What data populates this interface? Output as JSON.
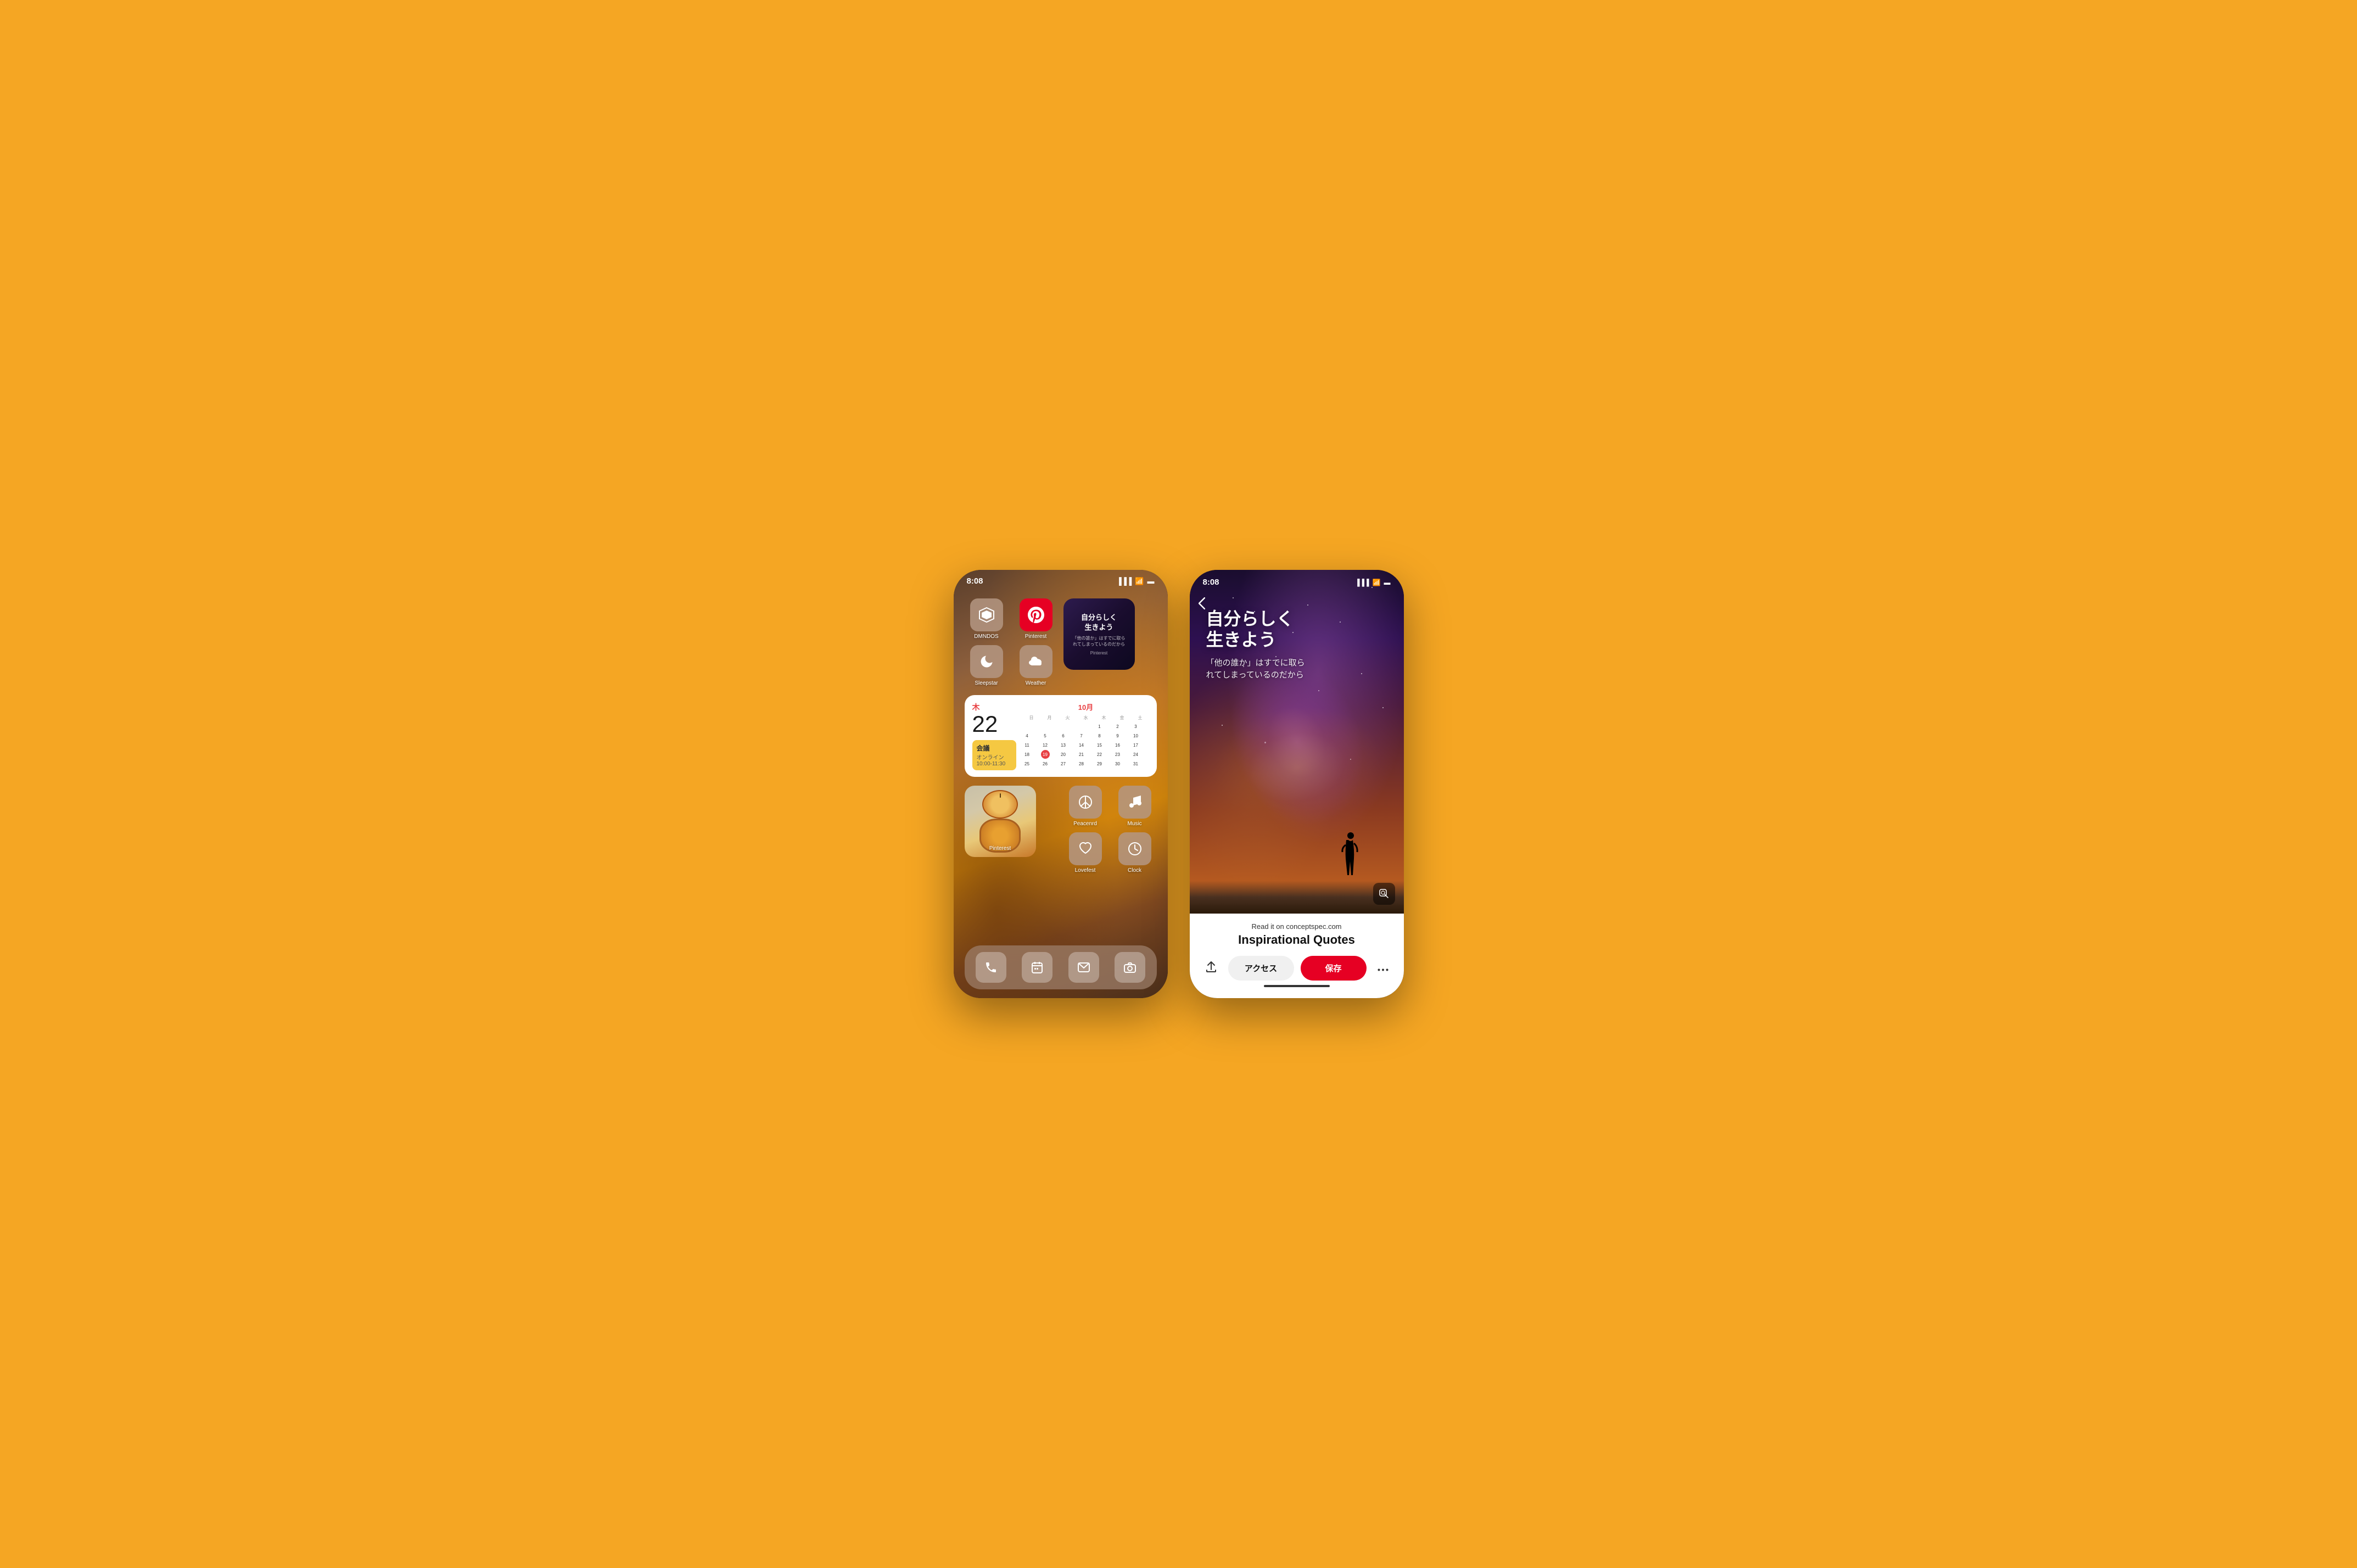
{
  "background": "#F5A623",
  "left_phone": {
    "status_time": "8:08",
    "apps_row1": [
      {
        "id": "dmndos",
        "label": "DMNDOS",
        "icon": "◇",
        "bg": "dmndos"
      },
      {
        "id": "pinterest",
        "label": "Pinterest",
        "icon": "P",
        "bg": "pinterest-red"
      }
    ],
    "widget_quote": {
      "main": "自分らしく\n生きよう",
      "sub": "「他の誰か」はすでに取ら\nれてしまっているのだから",
      "label": "Pinterest"
    },
    "apps_row2": [
      {
        "id": "sleepstar",
        "label": "Sleepstar",
        "icon": "☽",
        "bg": "sleepstar"
      },
      {
        "id": "weather",
        "label": "Weather",
        "icon": "⛅",
        "bg": "weather"
      }
    ],
    "calendar": {
      "day_label": "木",
      "date": "22",
      "month_label": "10月",
      "event_title": "会議",
      "event_loc": "オンライン",
      "event_time": "10:00-11:30",
      "days_header": [
        "日",
        "月",
        "火",
        "水",
        "木",
        "金",
        "土"
      ],
      "weeks": [
        [
          "",
          "",
          "",
          "",
          "1",
          "2",
          "3"
        ],
        [
          "4",
          "5",
          "6",
          "7",
          "8",
          "9",
          "10"
        ],
        [
          "11",
          "12",
          "13",
          "14",
          "15",
          "16",
          "17"
        ],
        [
          "18",
          "19",
          "20",
          "21",
          "22",
          "23",
          "24"
        ],
        [
          "25",
          "26",
          "27",
          "28",
          "29",
          "30",
          "31"
        ]
      ],
      "today": "19"
    },
    "apps_bottom": [
      {
        "id": "peacenrd",
        "label": "Peacenrd",
        "icon": "☮",
        "bg": "sleepstar"
      },
      {
        "id": "music",
        "label": "Music",
        "icon": "♪",
        "bg": "sleepstar"
      },
      {
        "id": "lovefest",
        "label": "Lovefest",
        "icon": "♡",
        "bg": "sleepstar"
      },
      {
        "id": "clock",
        "label": "Clock",
        "icon": "⊙",
        "bg": "sleepstar"
      }
    ],
    "photo_widget_label": "Pinterest",
    "dock": [
      {
        "id": "phone",
        "icon": "📞"
      },
      {
        "id": "calendar",
        "icon": "📅"
      },
      {
        "id": "mail",
        "icon": "✉"
      },
      {
        "id": "camera",
        "icon": "📷"
      }
    ]
  },
  "right_phone": {
    "status_time": "8:08",
    "back_label": "‹",
    "quote_main": "自分らしく\n生きよう",
    "quote_sub": "「他の誰か」はすでに取ら\nれてしまっているのだから",
    "source_prefix": "Read it on ",
    "source_site": "conceptspec.com",
    "title": "Inspirational Quotes",
    "btn_share": "↑",
    "btn_access": "アクセス",
    "btn_save": "保存",
    "btn_more": "•••"
  }
}
